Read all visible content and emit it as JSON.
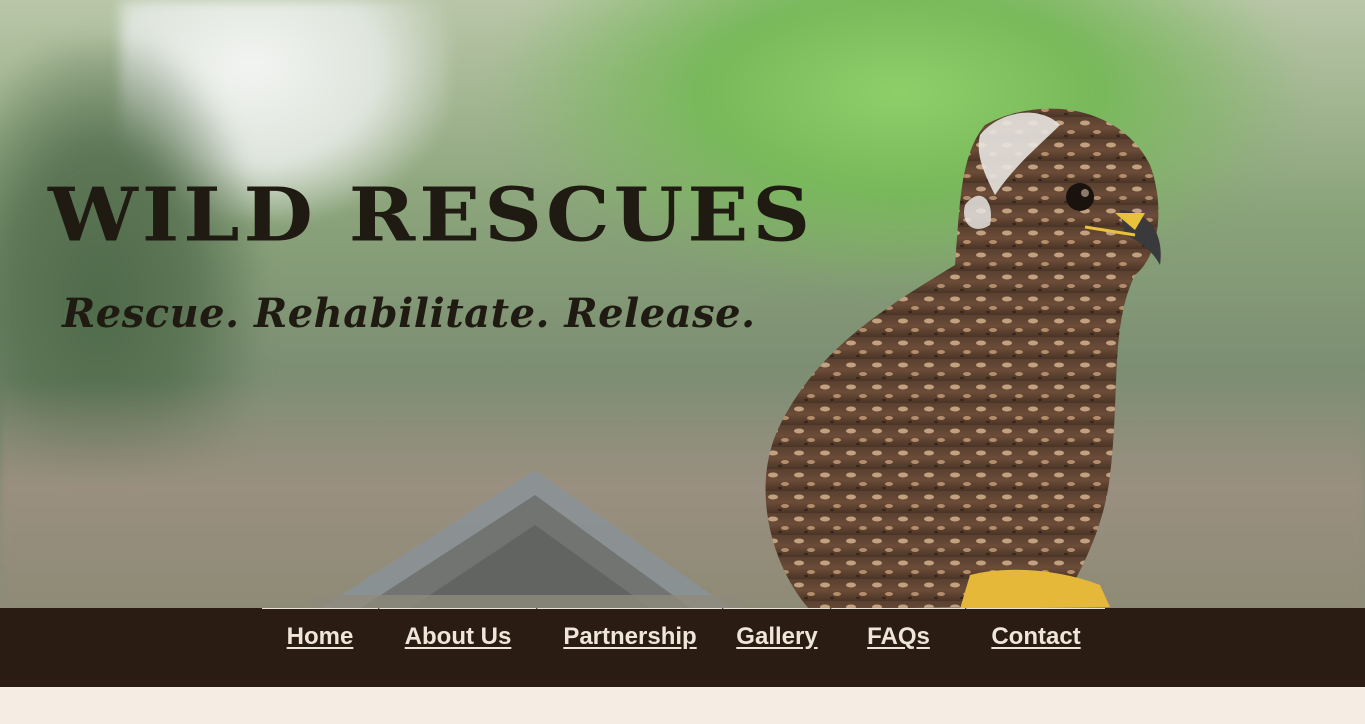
{
  "site": {
    "title": "WILD RESCUES",
    "tagline": "Rescue. Rehabilitate. Release."
  },
  "nav": {
    "items": [
      {
        "label": "Home"
      },
      {
        "label": "About Us"
      },
      {
        "label": "Partnership"
      },
      {
        "label": "Gallery"
      },
      {
        "label": "FAQs"
      },
      {
        "label": "Contact"
      }
    ]
  },
  "colors": {
    "nav_background": "#2a1c12",
    "nav_text": "#efe6da",
    "page_background": "#f5ece3",
    "title_text": "#1f1a12"
  },
  "hero": {
    "image_subject": "hawk-perched-photo"
  }
}
